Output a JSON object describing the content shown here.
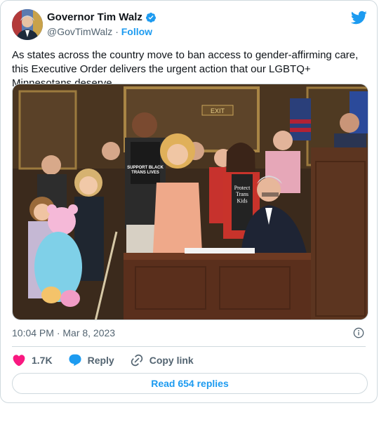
{
  "author": {
    "name": "Governor Tim Walz",
    "handle": "@GovTimWalz",
    "separator": "·",
    "follow_label": "Follow",
    "avatar_icon": "portrait-avatar"
  },
  "tweet": {
    "text": "As states across the country move to ban access to gender-affirming care, this Executive Order delivers the urgent action that our LGBTQ+ Minnesotans deserve.",
    "timestamp": "10:04 PM · Mar 8, 2023",
    "image_icon": "photo-bill-signing"
  },
  "photo_text": {
    "shirt_1": "SUPPORT BLACK\nTRANS LIVES",
    "shirt_2": "Protect\nTrans\nKids",
    "sign": "EXIT"
  },
  "actions": {
    "like_count": "1.7K",
    "reply_label": "Reply",
    "copy_label": "Copy link"
  },
  "read_replies_label": "Read 654 replies",
  "colors": {
    "brand": "#1d9bf0",
    "like": "#f91880",
    "text": "#0f1419",
    "muted": "#536471",
    "border": "#cfd9de"
  }
}
